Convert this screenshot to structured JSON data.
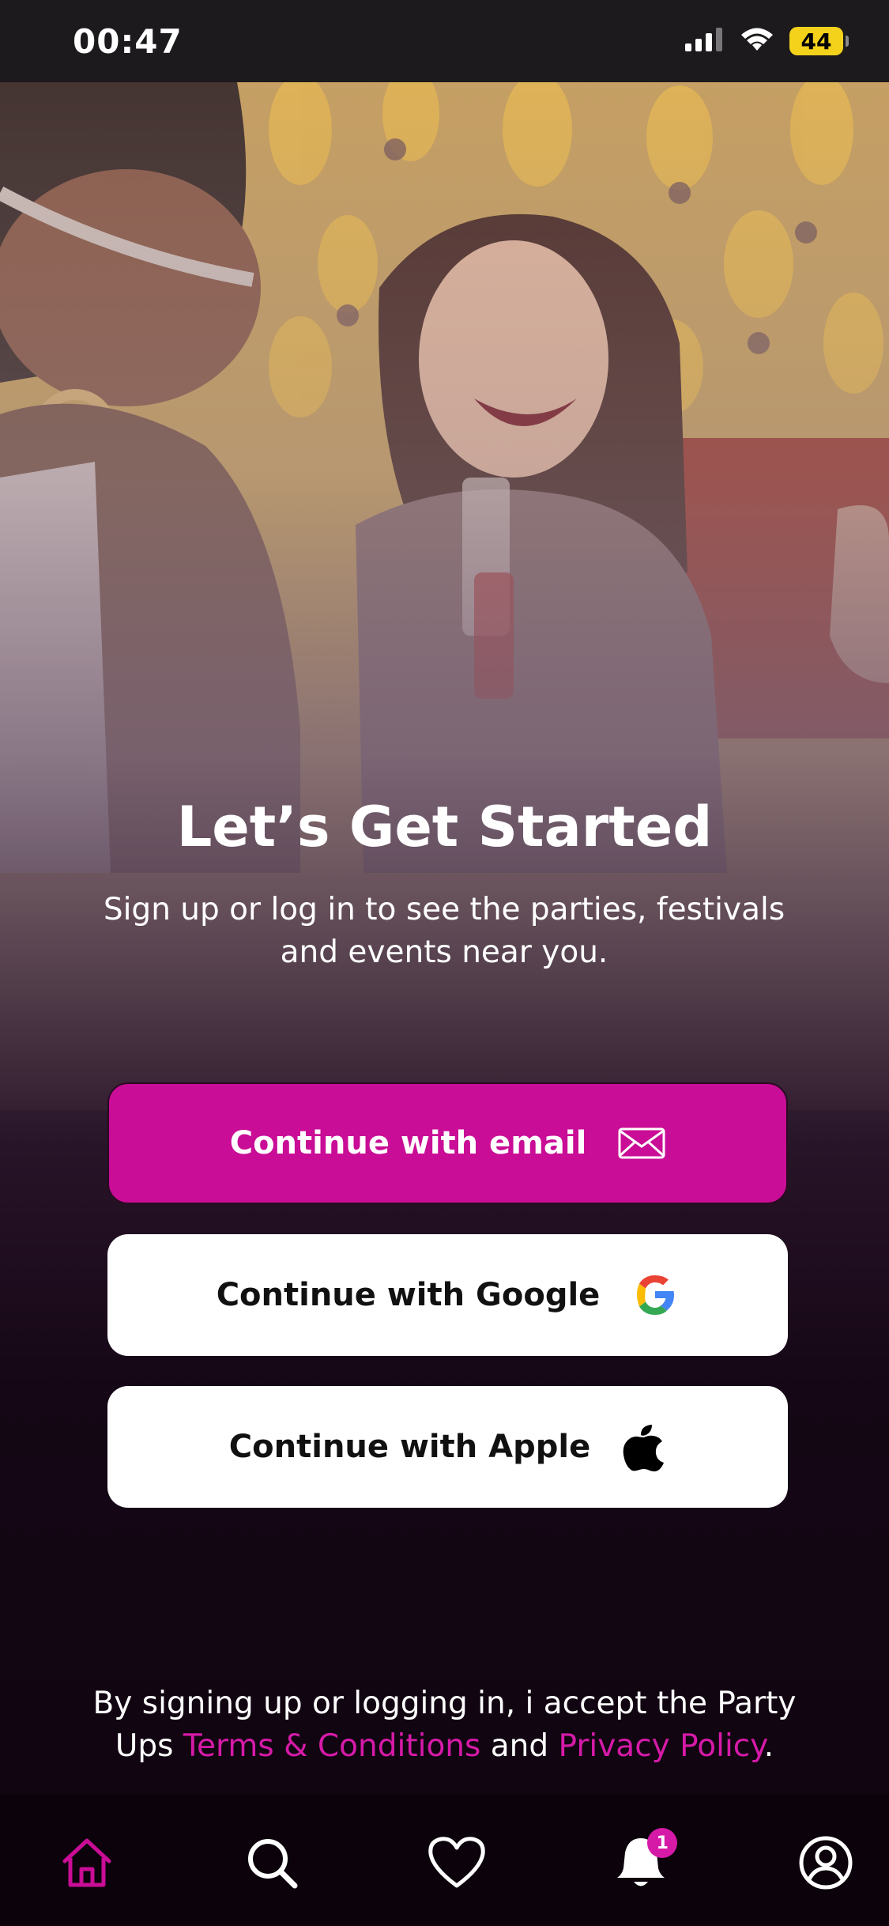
{
  "status_bar": {
    "time": "00:47",
    "battery": "44"
  },
  "hero": {
    "image": "party-photo"
  },
  "title": "Let’s Get Started",
  "subtitle": "Sign up or log in to see the parties, festivals and events near you.",
  "buttons": {
    "email": "Continue with email",
    "google": "Continue with Google",
    "apple": "Continue with Apple"
  },
  "legal": {
    "prefix": "By signing up or logging in, i accept the Party Ups ",
    "terms": "Terms & Conditions",
    "and": " and ",
    "privacy": "Privacy Policy",
    "suffix": "."
  },
  "tab_bar": {
    "items": [
      "home-icon",
      "search-icon",
      "heart-icon",
      "bell-icon",
      "profile-icon"
    ],
    "notification_count": "1"
  },
  "colors": {
    "accent": "#c90d96",
    "link": "#d61aa8",
    "background": "#100510"
  }
}
